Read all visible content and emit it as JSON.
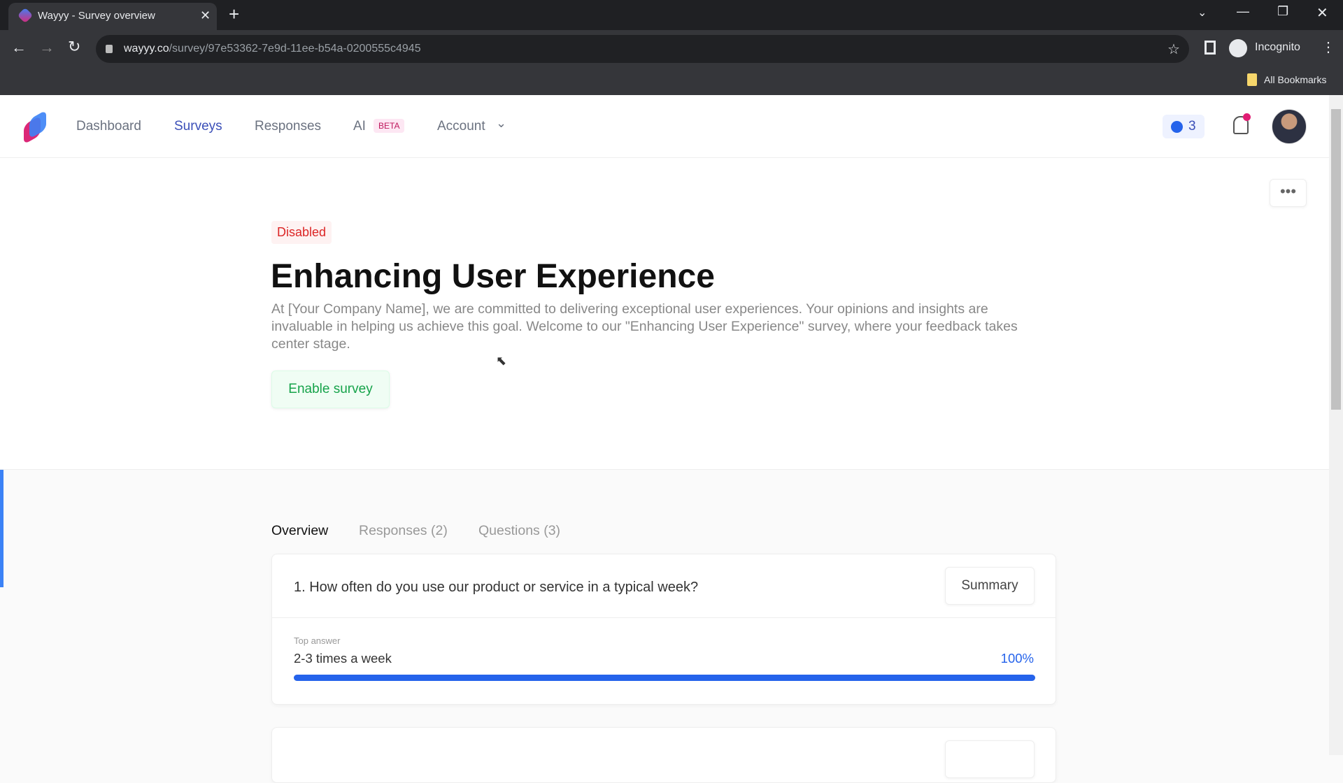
{
  "browser": {
    "tab_title": "Wayyy - Survey overview",
    "url_domain": "wayyy.co",
    "url_path": "/survey/97e53362-7e9d-11ee-b54a-0200555c4945",
    "profile": "Incognito",
    "bookmarks_label": "All Bookmarks"
  },
  "nav": {
    "items": [
      {
        "label": "Dashboard"
      },
      {
        "label": "Surveys",
        "active": true
      },
      {
        "label": "Responses"
      },
      {
        "label": "AI"
      },
      {
        "label": "Account"
      }
    ],
    "ai_badge": "BETA",
    "activity_count": "3",
    "colors": {
      "active": "#3b4fb8",
      "badge_bg": "#fde7f3",
      "badge_text": "#be185d"
    }
  },
  "survey": {
    "status": "Disabled",
    "title": "Enhancing User Experience",
    "description": "At [Your Company Name], we are committed to delivering exceptional user experiences. Your opinions and insights are invaluable in helping us achieve this goal. Welcome to our \"Enhancing User Experience\" survey, where your feedback takes center stage.",
    "enable_label": "Enable survey"
  },
  "tabs": [
    {
      "label": "Overview",
      "active": true
    },
    {
      "label": "Responses (2)"
    },
    {
      "label": "Questions (3)"
    }
  ],
  "questions": [
    {
      "title": "1. How often do you use our product or service in a typical week?",
      "summary_label": "Summary",
      "top_answer_label": "Top answer",
      "top_answer": "2-3 times a week",
      "percent_label": "100%",
      "percent": 100
    }
  ],
  "colors": {
    "accent": "#2563eb",
    "disabled": "#dc2626",
    "enable": "#16a34a"
  }
}
